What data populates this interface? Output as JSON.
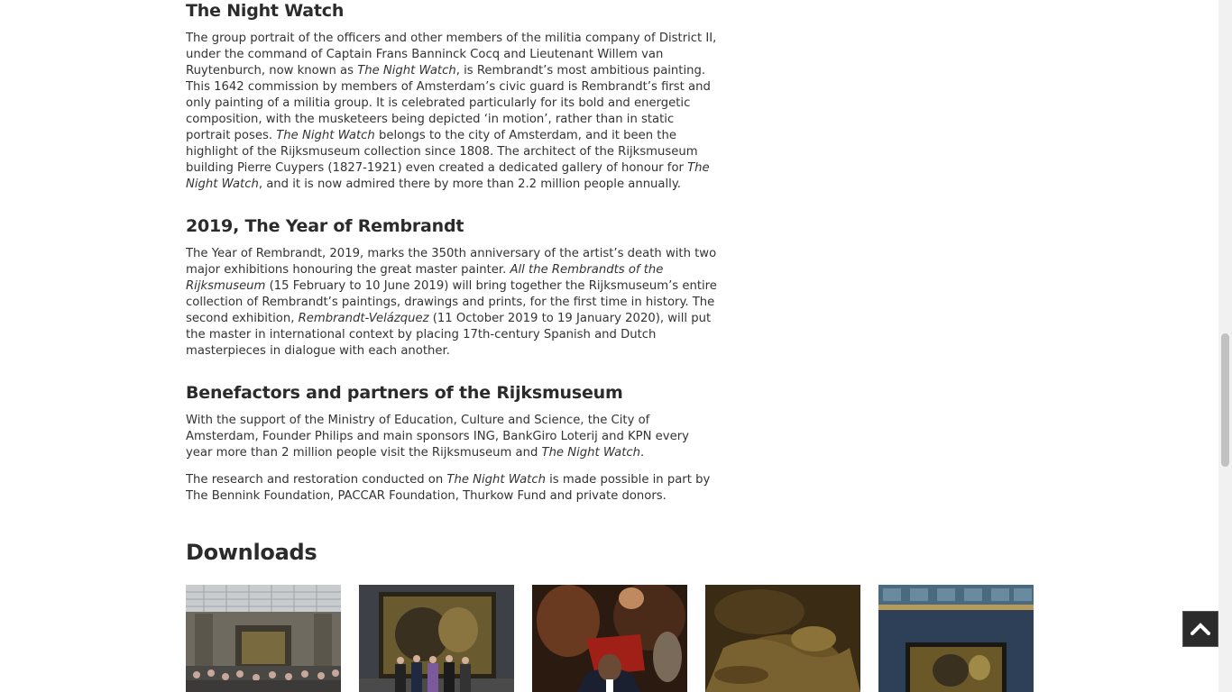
{
  "sections": [
    {
      "title": "The Night Watch",
      "paragraphs": [
        [
          {
            "t": "The group portrait of the officers and other members of the militia company of District II, under the command of Captain Frans Banninck Cocq and Lieutenant Willem van Ruytenburch, now known as "
          },
          {
            "t": "The Night Watch",
            "i": true
          },
          {
            "t": ", is Rembrandt’s most ambitious painting. This 1642 commission by members of Amsterdam’s civic guard is Rembrandt’s first and only painting of a militia group. It is celebrated particularly for its bold and energetic composition, with the musketeers being depicted ‘in motion’, rather than in static portrait poses. "
          },
          {
            "t": "The Night Watch",
            "i": true
          },
          {
            "t": " belongs to the city of Amsterdam, and it been the highlight of the Rijksmuseum collection since 1808. The architect of the Rijksmuseum building Pierre Cuypers (1827-1921) even created a dedicated gallery of honour for "
          },
          {
            "t": "The Night Watch",
            "i": true
          },
          {
            "t": ", and it is now admired there by more than 2.2 million people annually."
          }
        ]
      ]
    },
    {
      "title": "2019, The Year of Rembrandt",
      "paragraphs": [
        [
          {
            "t": "The Year of Rembrandt, 2019, marks the 350th anniversary of the artist’s death with two major exhibitions honouring the great master painter. "
          },
          {
            "t": "All the Rembrandts of the Rijksmuseum",
            "i": true
          },
          {
            "t": " (15 February to 10 June 2019) will bring together the Rijksmuseum’s entire collection of Rembrandt’s paintings, drawings and prints, for the first time in history. The second exhibition, "
          },
          {
            "t": "Rembrandt-Velázquez",
            "i": true
          },
          {
            "t": " (11 October 2019 to 19 January 2020), will put the master in international context by placing 17th-century Spanish and Dutch masterpieces in dialogue with each another."
          }
        ]
      ]
    },
    {
      "title": "Benefactors and partners of the Rijksmuseum",
      "paragraphs": [
        [
          {
            "t": "With the support of the Ministry of Education, Culture and Science, the City of Amsterdam, Founder Philips and main sponsors ING, BankGiro Loterij and KPN every year more than 2 million people visit the Rijksmuseum and "
          },
          {
            "t": "The Night Watch",
            "i": true
          },
          {
            "t": "."
          }
        ],
        [
          {
            "t": "The research and restoration conducted on "
          },
          {
            "t": "The Night Watch",
            "i": true
          },
          {
            "t": " is made possible in part by The Bennink Foundation, PACCAR Foundation, Thurkow Fund and private donors."
          }
        ]
      ]
    }
  ],
  "downloads": {
    "title": "Downloads",
    "thumbnails": [
      {
        "icon": "gallery-crowd-photo"
      },
      {
        "icon": "group-photo-night-watch"
      },
      {
        "icon": "obama-night-watch-photo"
      },
      {
        "icon": "painting-detail-photo"
      },
      {
        "icon": "gallery-of-honour-photo"
      }
    ]
  },
  "back_to_top": {
    "icon": "chevron-up-icon"
  },
  "colors": {
    "text": "#333333",
    "heading": "#2b2b2b",
    "button": "#2b2b2b"
  }
}
